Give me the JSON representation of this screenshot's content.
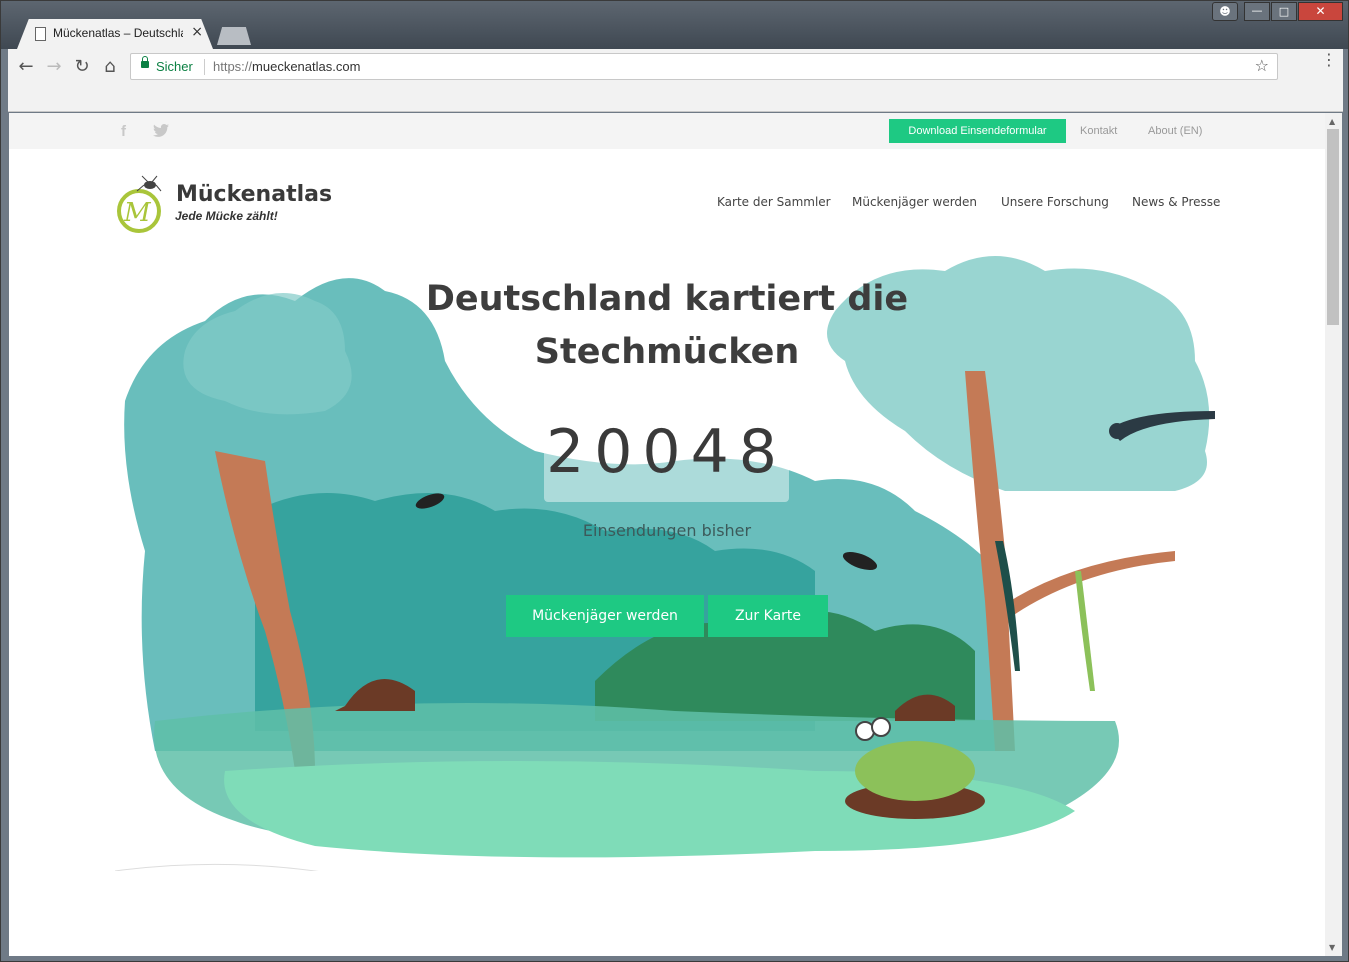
{
  "browser": {
    "tab_title": "Mückenatlas – Deutschla",
    "tab_close": "×",
    "secure_label": "Sicher",
    "url_protocol": "https://",
    "url_host": "mueckenatlas.com",
    "back_icon": "←",
    "forward_icon": "→",
    "reload_icon": "↻",
    "home_icon": "⌂",
    "star_icon": "☆",
    "menu_icon": "⋮"
  },
  "topbar": {
    "facebook_icon": "f",
    "twitter_icon": "t",
    "download_label": "Download Einsendeformular",
    "kontakt_label": "Kontakt",
    "about_label": "About (EN)"
  },
  "header": {
    "brand": "Mückenatlas",
    "tagline": "Jede Mücke zählt!",
    "nav": [
      {
        "label": "Karte der Sammler"
      },
      {
        "label": "Mückenjäger werden"
      },
      {
        "label": "Unsere Forschung"
      },
      {
        "label": "News & Presse"
      }
    ]
  },
  "hero": {
    "headline_line1": "Deutschland kartiert die",
    "headline_line2": "Stechmücken",
    "count": "20048",
    "count_label": "Einsendungen bisher",
    "cta_primary": "Mückenjäger werden",
    "cta_secondary": "Zur Karte"
  },
  "colors": {
    "accent_green": "#1ec983",
    "teal": "#4fb3b0",
    "water": "#7fd9b8"
  }
}
